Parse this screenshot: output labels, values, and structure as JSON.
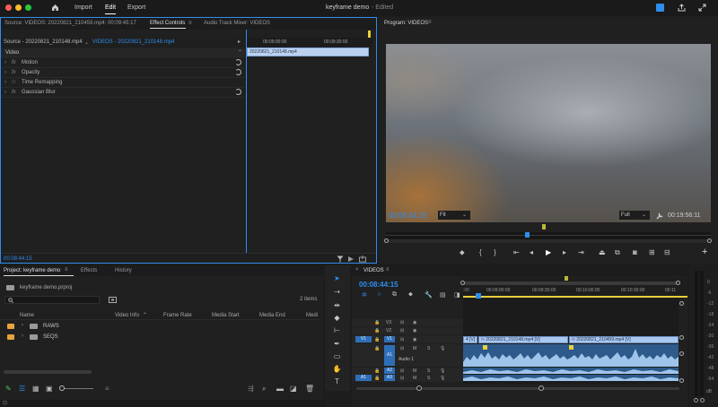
{
  "app": {
    "title": "keyframe demo",
    "edited": "- Edited",
    "nav": {
      "import": "Import",
      "edit": "Edit",
      "export": "Export"
    }
  },
  "source_panel": {
    "tabs": {
      "source": "Source: VIDEOS: 20220821_210459.mp4: 00:09:45:17",
      "effect_controls": "Effect Controls",
      "audio_mixer": "Audio Track Mixer: VIDEOS"
    },
    "clip_selector": "Source - 20220821_210148.mp4",
    "sequence_selector": "VIDEOS - 20220821_210148.mp4",
    "section_label": "Video",
    "effects": [
      {
        "name": "Motion",
        "fx": "fx"
      },
      {
        "name": "Opacity",
        "fx": "fx"
      },
      {
        "name": "Time Remapping",
        "fx": "fx"
      },
      {
        "name": "Gaussian Blur",
        "fx": "fx"
      }
    ],
    "timecode_start": "00:09:00:00",
    "timecode_end": "00:09:30:00",
    "mini_clip": "20220821_210148.mp4",
    "current_time": "00:08:44:15"
  },
  "program_panel": {
    "title": "Program: VIDEOS",
    "timecode": "00:08:44:15",
    "fit": "Fit",
    "quality": "Full",
    "duration": "00:19:56:11",
    "playhead_fraction": 0.42
  },
  "project_panel": {
    "tabs": {
      "project": "Project: keyframe demo",
      "effects": "Effects",
      "history": "History"
    },
    "file": "keyframe demo.prproj",
    "search_placeholder": "",
    "item_count": "2 items",
    "columns": [
      "Name",
      "Video Info",
      "Frame Rate",
      "Media Start",
      "Media End",
      "Medi"
    ],
    "items": [
      {
        "name": "RAWS",
        "color": "#e8a33a"
      },
      {
        "name": "SEQS",
        "color": "#e8a33a"
      }
    ]
  },
  "timeline": {
    "sequence": "VIDEOS",
    "timecode": "00:08:44:15",
    "ruler": [
      "00:09:00:00",
      "00:09:30:00",
      "00:10:00:00",
      "00:10:30:00",
      "00:11"
    ],
    "tracks": {
      "v3": "V3",
      "v2": "V2",
      "v1": "V1",
      "v1_src": "V1",
      "a1": "A1",
      "a1_src": "A1",
      "a1_name": "Audio 1",
      "a2": "A2",
      "a3": "A3",
      "m": "M",
      "s": "S"
    },
    "clips": [
      {
        "name": "4 [V]",
        "fx": "fx"
      },
      {
        "name": "20220821_210148.mp4 [V]",
        "fx": "fx"
      },
      {
        "name": "20220821_210459.mp4 [V]",
        "fx": "fx"
      }
    ]
  },
  "meter": {
    "labels": [
      "0",
      "-6",
      "-12",
      "-18",
      "-24",
      "-30",
      "-36",
      "-42",
      "-48",
      "-54"
    ],
    "bottom_label": "dB"
  },
  "colors": {
    "accent": "#2e8ded",
    "folder": "#e8a33a",
    "video_clip": "#a8c8f0",
    "audio_clip": "#2d5a8a",
    "work_area": "#e8d03a"
  }
}
